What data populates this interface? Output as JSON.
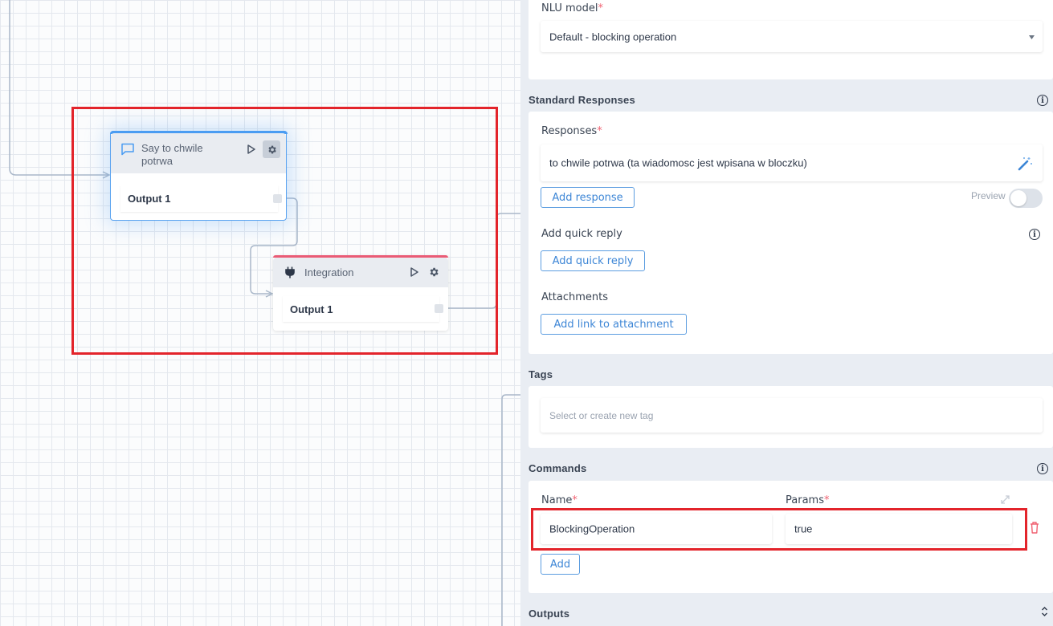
{
  "canvas": {
    "nodes": [
      {
        "title": "Say to chwile potrwa",
        "output": "Output 1",
        "accent": "#4a9cf2"
      },
      {
        "title": "Integration",
        "output": "Output 1",
        "accent": "#ea5b75"
      }
    ]
  },
  "panel": {
    "nlu": {
      "label": "NLU model",
      "value": "Default - blocking operation"
    },
    "standard_responses": {
      "title": "Standard Responses",
      "responses_label": "Responses",
      "response_text": "to chwile potrwa (ta wiadomosc jest wpisana w bloczku)",
      "add_response": "Add response",
      "preview_label": "Preview",
      "quick_reply_label": "Add quick reply",
      "quick_reply_button": "Add quick reply",
      "attachments_label": "Attachments",
      "attachment_button": "Add link to attachment"
    },
    "tags": {
      "title": "Tags",
      "placeholder": "Select or create new tag"
    },
    "commands": {
      "title": "Commands",
      "name_label": "Name",
      "params_label": "Params",
      "name_value": "BlockingOperation",
      "params_value": "true",
      "add_button": "Add"
    },
    "outputs": {
      "title": "Outputs"
    }
  },
  "colors": {
    "highlight": "#e3242b",
    "accent_blue": "#3d86d6",
    "required": "#f06272",
    "delete": "#f06272"
  }
}
